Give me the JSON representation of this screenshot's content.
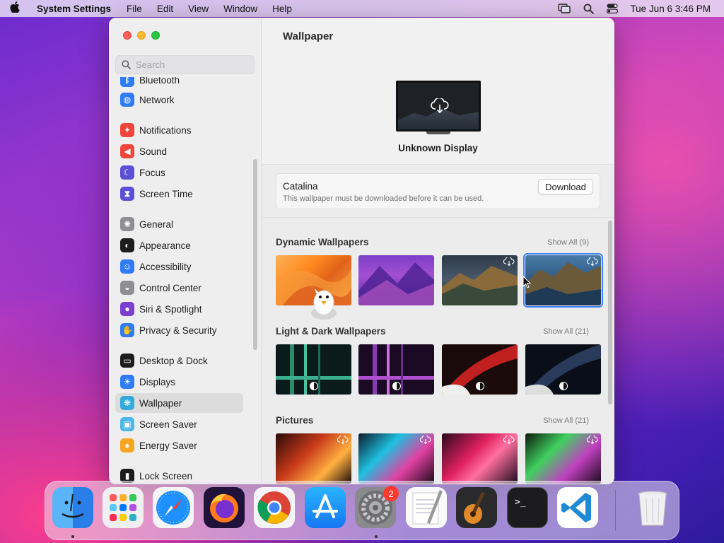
{
  "menubar": {
    "app_name": "System Settings",
    "menus": [
      "File",
      "Edit",
      "View",
      "Window",
      "Help"
    ],
    "clock": "Tue Jun 6  3:46 PM"
  },
  "sidebar": {
    "search_placeholder": "Search",
    "items": [
      {
        "label": "Bluetooth",
        "icon": "bluetooth-icon",
        "color": "#2f7cf6"
      },
      {
        "label": "Network",
        "icon": "globe-icon",
        "color": "#2f7cf6"
      },
      {
        "label": "Notifications",
        "icon": "bell-icon",
        "color": "#f0453a"
      },
      {
        "label": "Sound",
        "icon": "speaker-icon",
        "color": "#f0453a"
      },
      {
        "label": "Focus",
        "icon": "moon-icon",
        "color": "#5b4fd6"
      },
      {
        "label": "Screen Time",
        "icon": "hourglass-icon",
        "color": "#5b4fd6"
      },
      {
        "label": "General",
        "icon": "gear-icon",
        "color": "#8e8e93"
      },
      {
        "label": "Appearance",
        "icon": "appearance-icon",
        "color": "#1c1c1e"
      },
      {
        "label": "Accessibility",
        "icon": "accessibility-icon",
        "color": "#2f7cf6"
      },
      {
        "label": "Control Center",
        "icon": "toggles-icon",
        "color": "#8e8e93"
      },
      {
        "label": "Siri & Spotlight",
        "icon": "siri-icon",
        "color": "#7b3fd0"
      },
      {
        "label": "Privacy & Security",
        "icon": "hand-icon",
        "color": "#2f7cf6"
      },
      {
        "label": "Desktop & Dock",
        "icon": "dock-icon",
        "color": "#1c1c1e"
      },
      {
        "label": "Displays",
        "icon": "sun-icon",
        "color": "#2f7cf6"
      },
      {
        "label": "Wallpaper",
        "icon": "snowflake-icon",
        "color": "#35aadc"
      },
      {
        "label": "Screen Saver",
        "icon": "screensaver-icon",
        "color": "#4cb8e8"
      },
      {
        "label": "Energy Saver",
        "icon": "bulb-icon",
        "color": "#f5a623"
      },
      {
        "label": "Lock Screen",
        "icon": "lock-icon",
        "color": "#1c1c1e"
      }
    ],
    "active": "Wallpaper"
  },
  "main": {
    "title": "Wallpaper",
    "display_name": "Unknown Display",
    "download": {
      "title": "Catalina",
      "subtitle": "This wallpaper must be downloaded before it can be used.",
      "button": "Download"
    },
    "sections": [
      {
        "title": "Dynamic Wallpapers",
        "show_all": "Show All (9)"
      },
      {
        "title": "Light & Dark Wallpapers",
        "show_all": "Show All (21)"
      },
      {
        "title": "Pictures",
        "show_all": "Show All (21)"
      }
    ]
  },
  "dock": {
    "apps": [
      "Finder",
      "Launchpad",
      "Safari",
      "Firefox",
      "Chrome",
      "App Store",
      "System Settings",
      "TextEdit",
      "GarageBand",
      "Terminal",
      "Visual Studio Code",
      "Trash"
    ],
    "settings_badge": "2"
  }
}
